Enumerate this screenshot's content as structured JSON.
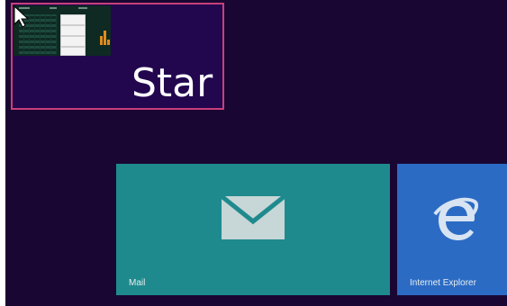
{
  "start": {
    "title": "Star",
    "accent_color": "#c7407a",
    "cursor_icon": "arrow-cursor-icon"
  },
  "tiles": [
    {
      "label": "Mail",
      "icon": "mail-envelope-icon",
      "color": "#1f8a8d"
    },
    {
      "label": "Internet Explorer",
      "icon": "internet-explorer-icon",
      "color": "#2c6bc4"
    }
  ],
  "background_color": "#1a0633"
}
